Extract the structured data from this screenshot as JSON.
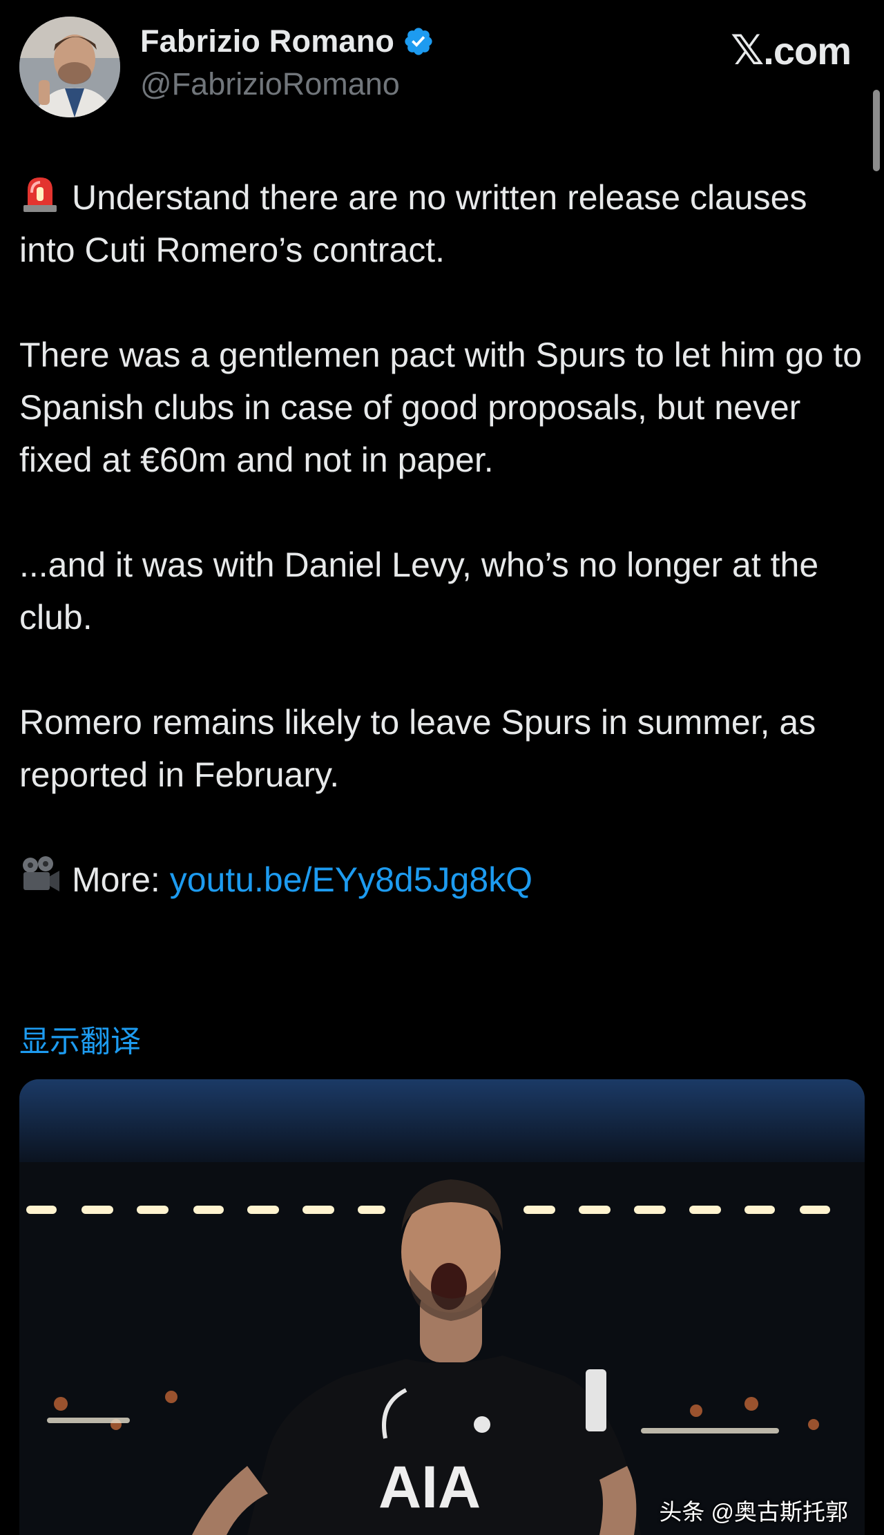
{
  "author": {
    "display_name": "Fabrizio Romano",
    "handle": "@FabrizioRomano",
    "avatar_icon": "profile-photo",
    "verified_icon": "verified-badge-icon",
    "verified_color": "#1d9bf0"
  },
  "site": {
    "logo_x": "𝕏",
    "logo_text": ".com"
  },
  "tweet": {
    "p1": "Understand there are no written release clauses into Cuti Romero’s contract.",
    "p1_icon": "siren-emoji-icon",
    "p2": "There was a gentlemen pact with Spurs to let him go to Spanish clubs in case of good proposals, but never fixed at €60m and not in paper.",
    "p3": "...and it was with Daniel Levy, who’s no longer at the club.",
    "p4": "Romero remains likely to leave Spurs in summer, as reported in February.",
    "p5_prefix": "More: ",
    "p5_icon": "movie-camera-emoji-icon",
    "link": "youtu.be/EYy8d5Jg8kQ"
  },
  "translate_label": "显示翻译",
  "media": {
    "description_icon": "football-player-photo",
    "shirt_text": "AIA"
  },
  "watermark": "头条 @奥古斯托郭",
  "colors": {
    "background": "#000000",
    "text": "#e7e9ea",
    "muted": "#71767b",
    "link": "#1d9bf0"
  }
}
